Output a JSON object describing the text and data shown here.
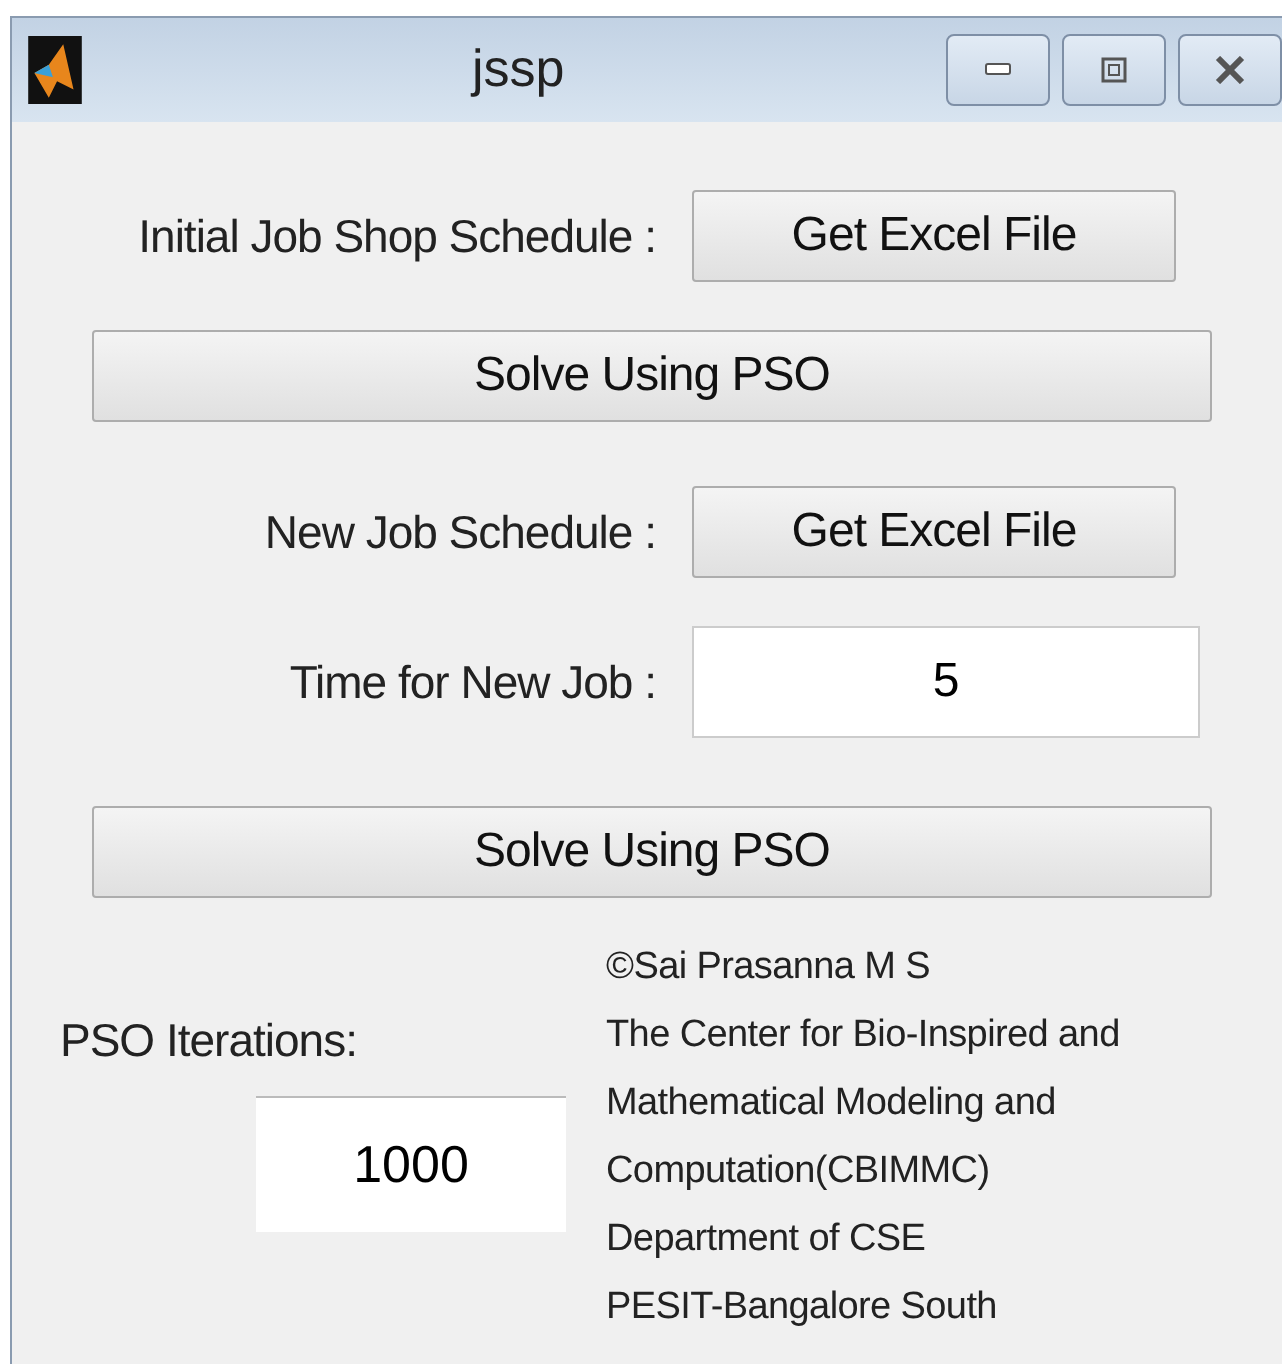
{
  "window": {
    "title": "jssp"
  },
  "rows": [
    {
      "kind": "label_button",
      "label": "Initial Job Shop Schedule :",
      "button": "Get Excel File"
    },
    {
      "kind": "button",
      "button": "Solve Using PSO"
    },
    {
      "kind": "label_button",
      "label": "New Job Schedule :",
      "button": "Get Excel File"
    },
    {
      "kind": "label_input",
      "label": "Time for New Job :",
      "value": "5"
    },
    {
      "kind": "button",
      "button": "Solve Using PSO"
    }
  ],
  "iterations": {
    "label": "PSO Iterations:",
    "value": "1000"
  },
  "credits": [
    "©Sai Prasanna M S",
    "The Center for Bio-Inspired and",
    "Mathematical Modeling and",
    "Computation(CBIMMC)",
    "Department of CSE",
    "PESIT-Bangalore South"
  ]
}
